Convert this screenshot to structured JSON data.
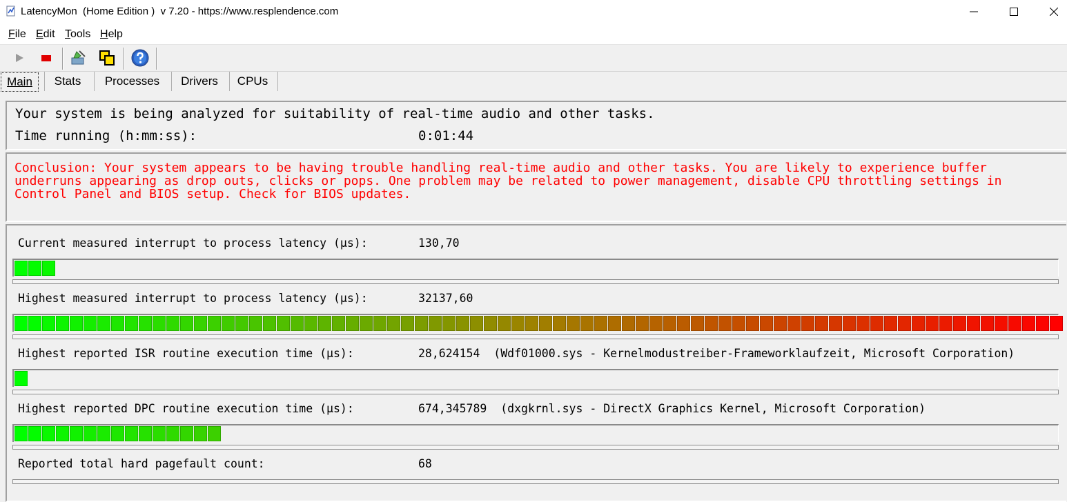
{
  "window": {
    "title": "LatencyMon  (Home Edition )  v 7.20 - https://www.resplendence.com"
  },
  "menu": [
    {
      "key": "F",
      "rest": "ile"
    },
    {
      "key": "E",
      "rest": "dit"
    },
    {
      "key": "T",
      "rest": "ools"
    },
    {
      "key": "H",
      "rest": "elp"
    }
  ],
  "toolbar": {
    "icons": [
      "play-icon",
      "stop-icon",
      "settings-wizard-icon",
      "windows-icon",
      "help-icon"
    ]
  },
  "tabs": [
    {
      "label": "Main",
      "active": true
    },
    {
      "label": "Stats",
      "active": false
    },
    {
      "label": "Processes",
      "active": false
    },
    {
      "label": "Drivers",
      "active": false
    },
    {
      "label": "CPUs",
      "active": false
    }
  ],
  "status": {
    "message": "Your system is being analyzed for suitability of real-time audio and other tasks.",
    "time_label": "Time running (h:mm:ss):",
    "time_value": "0:01:44"
  },
  "conclusion": "Conclusion: Your system appears to be having trouble handling real-time audio and other tasks. You are likely to experience buffer underruns appearing as drop outs, clicks or pops. One problem may be related to power management, disable CPU throttling settings in Control Panel and BIOS setup. Check for BIOS updates.",
  "metrics": [
    {
      "label": "Current measured interrupt to process latency (µs):",
      "value": "130,70",
      "level_segments": 3,
      "total_segments": 76
    },
    {
      "label": "Highest measured interrupt to process latency (µs):",
      "value": "32137,60",
      "level_segments": 76,
      "total_segments": 76
    },
    {
      "label": "Highest reported ISR routine execution time (µs):",
      "value": "28,624154  (Wdf01000.sys - Kernelmodustreiber-Frameworklaufzeit, Microsoft Corporation)",
      "level_segments": 1,
      "total_segments": 76
    },
    {
      "label": "Highest reported DPC routine execution time (µs):",
      "value": "674,345789  (dxgkrnl.sys - DirectX Graphics Kernel, Microsoft Corporation)",
      "level_segments": 15,
      "total_segments": 76
    },
    {
      "label": "Reported total hard pagefault count:",
      "value": "68"
    }
  ],
  "colors": {
    "conclusion_text": "#ff0000",
    "bar_low": "#00ff00",
    "bar_mid": "#a08000",
    "bar_high": "#ff0000"
  }
}
